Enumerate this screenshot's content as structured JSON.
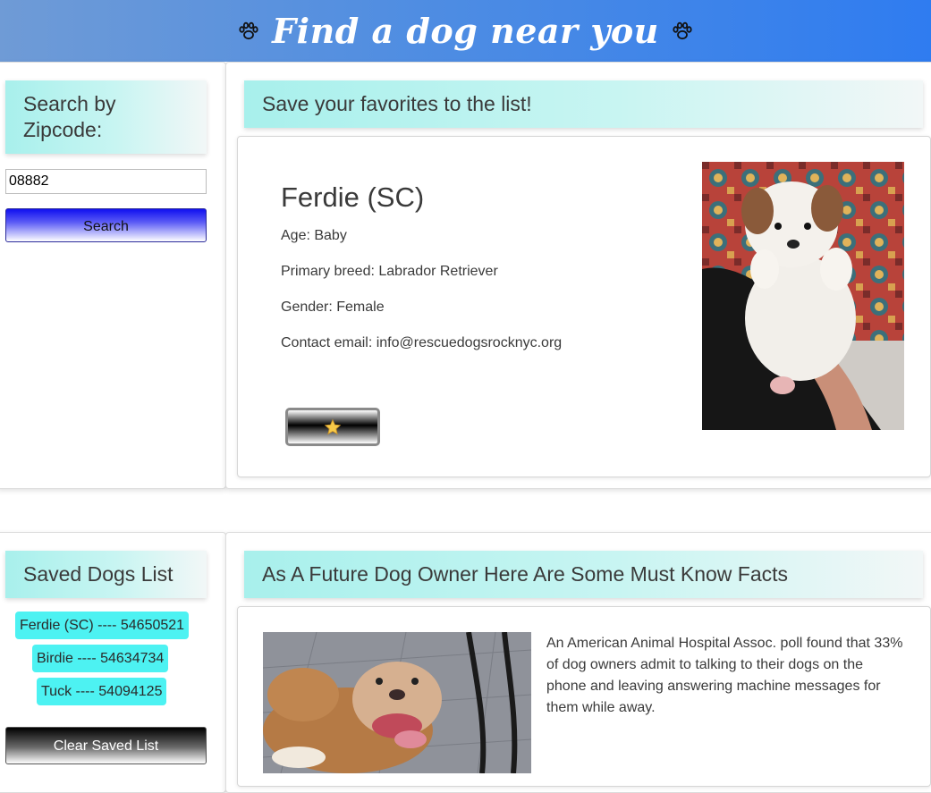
{
  "header": {
    "title": "Find a dog near you",
    "left_icon": "paw-icon",
    "right_icon": "paw-icon"
  },
  "search": {
    "heading": "Search by Zipcode:",
    "zip_value": "08882",
    "button_label": "Search"
  },
  "favorites": {
    "heading": "Save your favorites to the list!",
    "dog": {
      "name": "Ferdie (SC)",
      "age": "Age: Baby",
      "breed": "Primary breed: Labrador Retriever",
      "gender": "Gender: Female",
      "contact": "Contact email: info@rescuedogsrocknyc.org"
    },
    "favorite_icon": "star-icon"
  },
  "saved": {
    "heading": "Saved Dogs List",
    "items": [
      {
        "label": "Ferdie (SC) ---- 54650521"
      },
      {
        "label": "Birdie ---- 54634734"
      },
      {
        "label": "Tuck ---- 54094125"
      }
    ],
    "clear_label": "Clear Saved List"
  },
  "facts": {
    "heading": "As A Future Dog Owner Here Are Some Must Know Facts",
    "text": "An American Animal Hospital Assoc. poll found that 33% of dog owners admit to talking to their dogs on the phone and leaving answering machine messages for them while away."
  },
  "colors": {
    "header_gradient_start": "#6f9bd6",
    "header_gradient_end": "#2f7cf0",
    "section_head": "#a8f0ec",
    "saved_item": "#4df2f2",
    "search_button": "#1010f0"
  }
}
